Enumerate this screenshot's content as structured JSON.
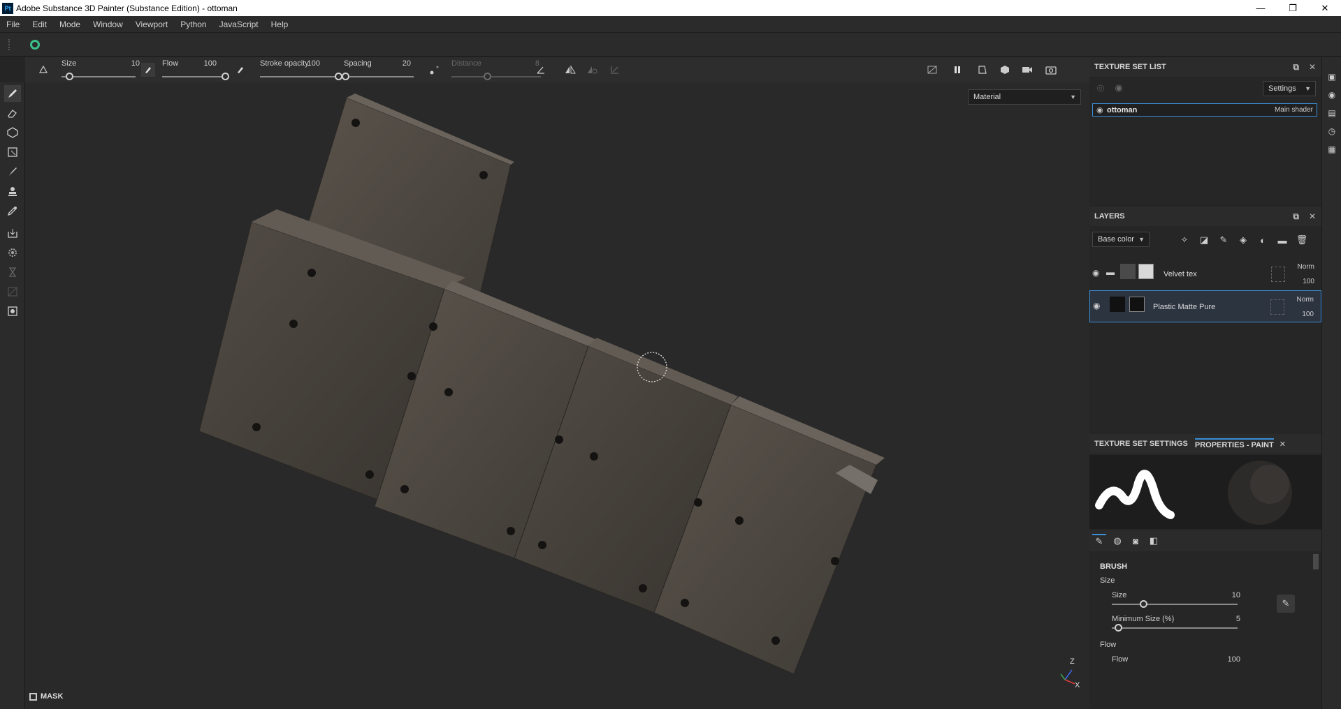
{
  "window": {
    "app_icon_text": "Pt",
    "title": "Adobe Substance 3D Painter (Substance Edition) - ottoman",
    "minimize": "—",
    "maximize": "❐",
    "close": "✕"
  },
  "menu": [
    "File",
    "Edit",
    "Mode",
    "Window",
    "Viewport",
    "Python",
    "JavaScript",
    "Help"
  ],
  "toolbar": {
    "size_label": "Size",
    "size_value": "10",
    "size_fraction": 0.1,
    "flow_label": "Flow",
    "flow_value": "100",
    "flow_fraction": 1.0,
    "stroke_opacity_label": "Stroke opacity",
    "stroke_opacity_value": "100",
    "stroke_opacity_fraction": 1.0,
    "spacing_label": "Spacing",
    "spacing_value": "20",
    "spacing_fraction": 0.02,
    "distance_label": "Distance",
    "distance_value": "8",
    "distance_fraction": 0.4
  },
  "viewport": {
    "material_mode": "Material",
    "mask_label": "MASK",
    "axis_z": "Z",
    "axis_x": "X"
  },
  "texture_set_list": {
    "title": "TEXTURE SET LIST",
    "settings_label": "Settings",
    "item_name": "ottoman",
    "item_shader": "Main shader"
  },
  "layers": {
    "title": "LAYERS",
    "channel": "Base color",
    "rows": [
      {
        "name": "Velvet tex",
        "blend": "Norm",
        "opacity": "100"
      },
      {
        "name": "Plastic Matte Pure",
        "blend": "Norm",
        "opacity": "100"
      }
    ]
  },
  "properties": {
    "tab_inactive": "TEXTURE SET SETTINGS",
    "tab_active": "PROPERTIES - PAINT",
    "section_brush": "BRUSH",
    "group_size": "Size",
    "size_label": "Size",
    "size_value": "10",
    "size_fraction": 0.25,
    "min_size_label": "Minimum Size (%)",
    "min_size_value": "5",
    "min_size_fraction": 0.05,
    "group_flow": "Flow",
    "flow_label": "Flow",
    "flow_value": "100"
  },
  "colors": {
    "accent": "#3b8fd8",
    "title_bg": "#ffffff",
    "panel_bg": "#262626",
    "viewport_bg": "#292929"
  }
}
